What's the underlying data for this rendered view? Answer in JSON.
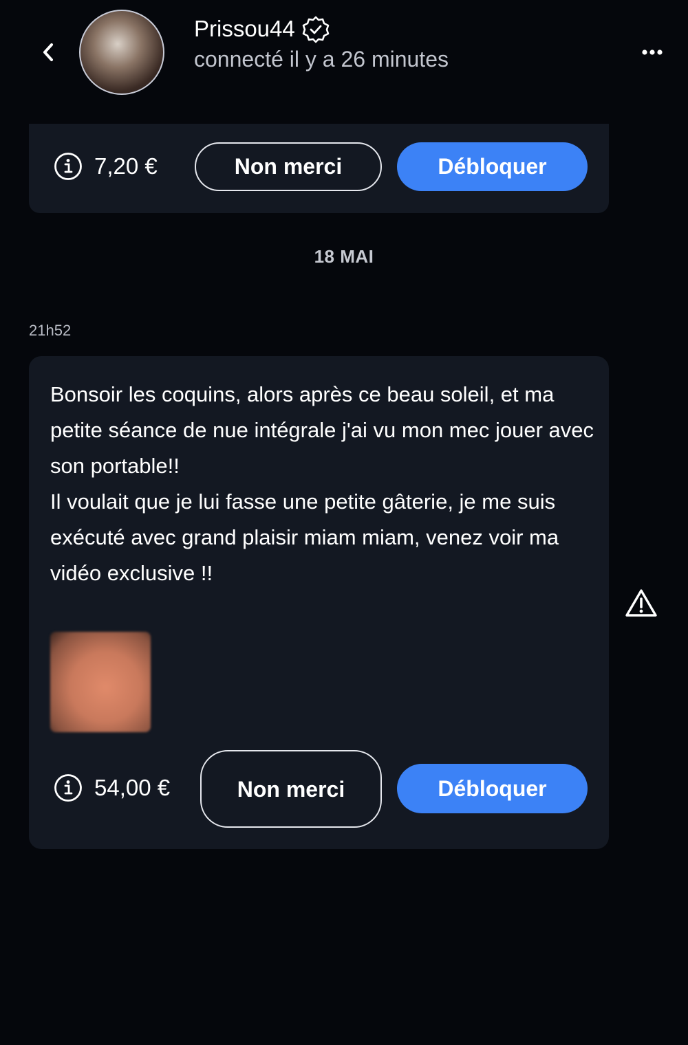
{
  "header": {
    "user_name": "Prissou44",
    "status": "connecté il y a 26 minutes"
  },
  "offer_top": {
    "price": "7,20 €",
    "decline_label": "Non merci",
    "unlock_label": "Débloquer"
  },
  "date_separator": "18 MAI",
  "message": {
    "time": "21h52",
    "text": "Bonsoir les coquins, alors après ce beau soleil, et ma petite séance de nue intégrale j'ai vu mon mec jouer avec son portable!!\nIl voulait que je lui fasse une petite gâterie, je me suis exécuté avec grand plaisir miam miam, venez voir ma vidéo exclusive !!",
    "price": "54,00 €",
    "decline_label": "Non merci",
    "unlock_label": "Débloquer"
  },
  "icons": [
    "back-arrow-icon",
    "verified-badge-icon",
    "more-options-icon",
    "info-icon",
    "warning-icon"
  ],
  "colors": {
    "background": "#05070c",
    "card": "#131822",
    "accent": "#3c82f6"
  }
}
